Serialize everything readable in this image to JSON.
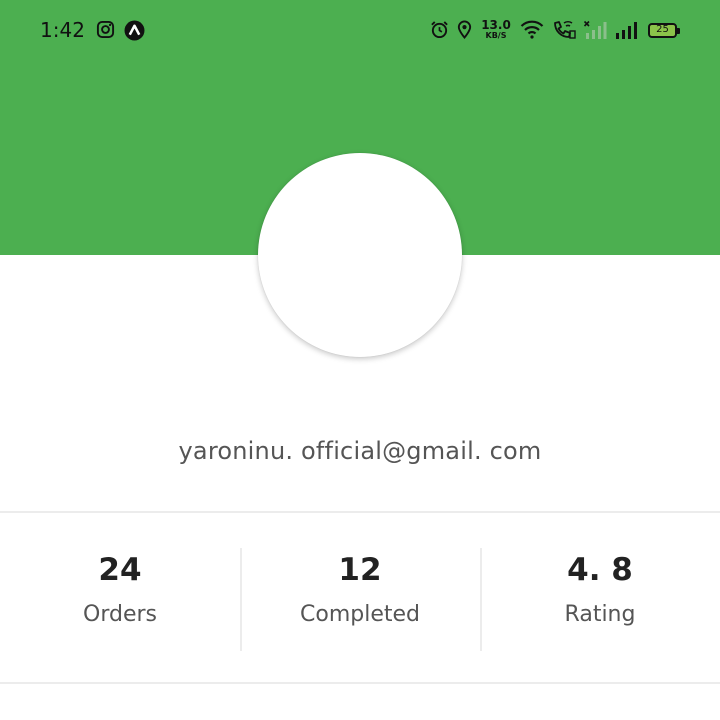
{
  "status_bar": {
    "time": "1:42",
    "network_speed_value": "13.0",
    "network_speed_unit": "KB/S",
    "battery_level": "25",
    "icons": [
      "instagram-icon",
      "app-notification-icon",
      "alarm-icon",
      "location-icon",
      "wifi-icon",
      "wifi-calling-icon",
      "signal-no-service-icon",
      "signal-icon",
      "battery-icon"
    ]
  },
  "profile": {
    "email": "yaroninu. official@gmail. com"
  },
  "stats": [
    {
      "value": "24",
      "label": "Orders"
    },
    {
      "value": "12",
      "label": "Completed"
    },
    {
      "value": "4. 8",
      "label": "Rating"
    }
  ],
  "colors": {
    "header": "#4caf50",
    "background": "#ffffff",
    "divider": "#ececec",
    "text_primary": "#222222",
    "text_secondary": "#555555"
  }
}
